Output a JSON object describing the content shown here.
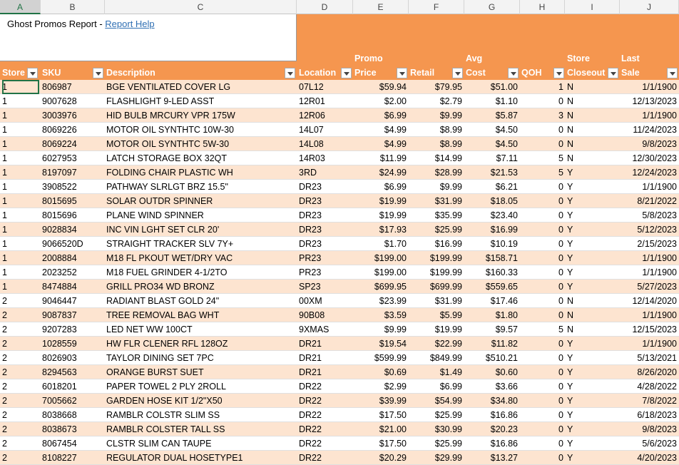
{
  "column_letters": [
    "A",
    "B",
    "C",
    "D",
    "E",
    "F",
    "G",
    "H",
    "I",
    "J"
  ],
  "title": {
    "text": "Ghost Promos Report - ",
    "link": "Report Help"
  },
  "headers": {
    "store": "Store",
    "sku": "SKU",
    "description": "Description",
    "location": "Location",
    "promo_top": "Promo",
    "promo_bottom": "Price",
    "retail": "Retail",
    "avg_top": "Avg",
    "avg_bottom": "Cost",
    "qoh": "QOH",
    "store_top": "Store",
    "store_bottom": "Closeout",
    "last_top": "Last",
    "last_bottom": "Sale"
  },
  "rows": [
    [
      "1",
      "806987",
      "BGE VENTILATED COVER LG",
      "07L12",
      "$59.94",
      "$79.95",
      "$51.00",
      "1",
      "N",
      "1/1/1900"
    ],
    [
      "1",
      "9007628",
      "FLASHLIGHT 9-LED ASST",
      "12R01",
      "$2.00",
      "$2.79",
      "$1.10",
      "0",
      "N",
      "12/13/2023"
    ],
    [
      "1",
      "3003976",
      "HID BULB MRCURY VPR 175W",
      "12R06",
      "$6.99",
      "$9.99",
      "$5.87",
      "3",
      "N",
      "1/1/1900"
    ],
    [
      "1",
      "8069226",
      "MOTOR OIL SYNTHTC 10W-30",
      "14L07",
      "$4.99",
      "$8.99",
      "$4.50",
      "0",
      "N",
      "11/24/2023"
    ],
    [
      "1",
      "8069224",
      "MOTOR OIL SYNTHTC 5W-30",
      "14L08",
      "$4.99",
      "$8.99",
      "$4.50",
      "0",
      "N",
      "9/8/2023"
    ],
    [
      "1",
      "6027953",
      "LATCH STORAGE BOX 32QT",
      "14R03",
      "$11.99",
      "$14.99",
      "$7.11",
      "5",
      "N",
      "12/30/2023"
    ],
    [
      "1",
      "8197097",
      "FOLDING CHAIR PLASTIC WH",
      "3RD",
      "$24.99",
      "$28.99",
      "$21.53",
      "5",
      "Y",
      "12/24/2023"
    ],
    [
      "1",
      "3908522",
      "PATHWAY SLRLGT BRZ 15.5\"",
      "DR23",
      "$6.99",
      "$9.99",
      "$6.21",
      "0",
      "Y",
      "1/1/1900"
    ],
    [
      "1",
      "8015695",
      "SOLAR OUTDR SPINNER",
      "DR23",
      "$19.99",
      "$31.99",
      "$18.05",
      "0",
      "Y",
      "8/21/2022"
    ],
    [
      "1",
      "8015696",
      "PLANE WIND SPINNER",
      "DR23",
      "$19.99",
      "$35.99",
      "$23.40",
      "0",
      "Y",
      "5/8/2023"
    ],
    [
      "1",
      "9028834",
      "INC VIN LGHT SET CLR 20'",
      "DR23",
      "$17.93",
      "$25.99",
      "$16.99",
      "0",
      "Y",
      "5/12/2023"
    ],
    [
      "1",
      "9066520D",
      "STRAIGHT TRACKER SLV 7Y+",
      "DR23",
      "$1.70",
      "$16.99",
      "$10.19",
      "0",
      "Y",
      "2/15/2023"
    ],
    [
      "1",
      "2008884",
      "M18 FL PKOUT WET/DRY VAC",
      "PR23",
      "$199.00",
      "$199.99",
      "$158.71",
      "0",
      "Y",
      "1/1/1900"
    ],
    [
      "1",
      "2023252",
      "M18 FUEL GRINDER 4-1/2TO",
      "PR23",
      "$199.00",
      "$199.99",
      "$160.33",
      "0",
      "Y",
      "1/1/1900"
    ],
    [
      "1",
      "8474884",
      "GRILL PRO34 WD BRONZ",
      "SP23",
      "$699.95",
      "$699.99",
      "$559.65",
      "0",
      "Y",
      "5/27/2023"
    ],
    [
      "2",
      "9046447",
      "RADIANT BLAST GOLD 24\"",
      "00XM",
      "$23.99",
      "$31.99",
      "$17.46",
      "0",
      "N",
      "12/14/2020"
    ],
    [
      "2",
      "9087837",
      "TREE REMOVAL BAG WHT",
      "90B08",
      "$3.59",
      "$5.99",
      "$1.80",
      "0",
      "N",
      "1/1/1900"
    ],
    [
      "2",
      "9207283",
      "LED NET WW 100CT",
      "9XMAS",
      "$9.99",
      "$19.99",
      "$9.57",
      "5",
      "N",
      "12/15/2023"
    ],
    [
      "2",
      "1028559",
      "HW FLR CLENER RFL 128OZ",
      "DR21",
      "$19.54",
      "$22.99",
      "$11.82",
      "0",
      "Y",
      "1/1/1900"
    ],
    [
      "2",
      "8026903",
      "TAYLOR DINING SET 7PC",
      "DR21",
      "$599.99",
      "$849.99",
      "$510.21",
      "0",
      "Y",
      "5/13/2021"
    ],
    [
      "2",
      "8294563",
      "ORANGE BURST SUET",
      "DR21",
      "$0.69",
      "$1.49",
      "$0.60",
      "0",
      "Y",
      "8/26/2020"
    ],
    [
      "2",
      "6018201",
      "PAPER TOWEL 2 PLY 2ROLL",
      "DR22",
      "$2.99",
      "$6.99",
      "$3.66",
      "0",
      "Y",
      "4/28/2022"
    ],
    [
      "2",
      "7005662",
      "GARDEN HOSE KIT 1/2\"X50",
      "DR22",
      "$39.99",
      "$54.99",
      "$34.80",
      "0",
      "Y",
      "7/8/2022"
    ],
    [
      "2",
      "8038668",
      "RAMBLR COLSTR SLIM SS",
      "DR22",
      "$17.50",
      "$25.99",
      "$16.86",
      "0",
      "Y",
      "6/18/2023"
    ],
    [
      "2",
      "8038673",
      "RAMBLR COLSTER TALL SS",
      "DR22",
      "$21.00",
      "$30.99",
      "$20.23",
      "0",
      "Y",
      "9/8/2023"
    ],
    [
      "2",
      "8067454",
      "CLSTR SLIM CAN TAUPE",
      "DR22",
      "$17.50",
      "$25.99",
      "$16.86",
      "0",
      "Y",
      "5/6/2023"
    ],
    [
      "2",
      "8108227",
      "REGULATOR DUAL HOSETYPE1",
      "DR22",
      "$20.29",
      "$29.99",
      "$13.27",
      "0",
      "Y",
      "4/20/2023"
    ]
  ]
}
